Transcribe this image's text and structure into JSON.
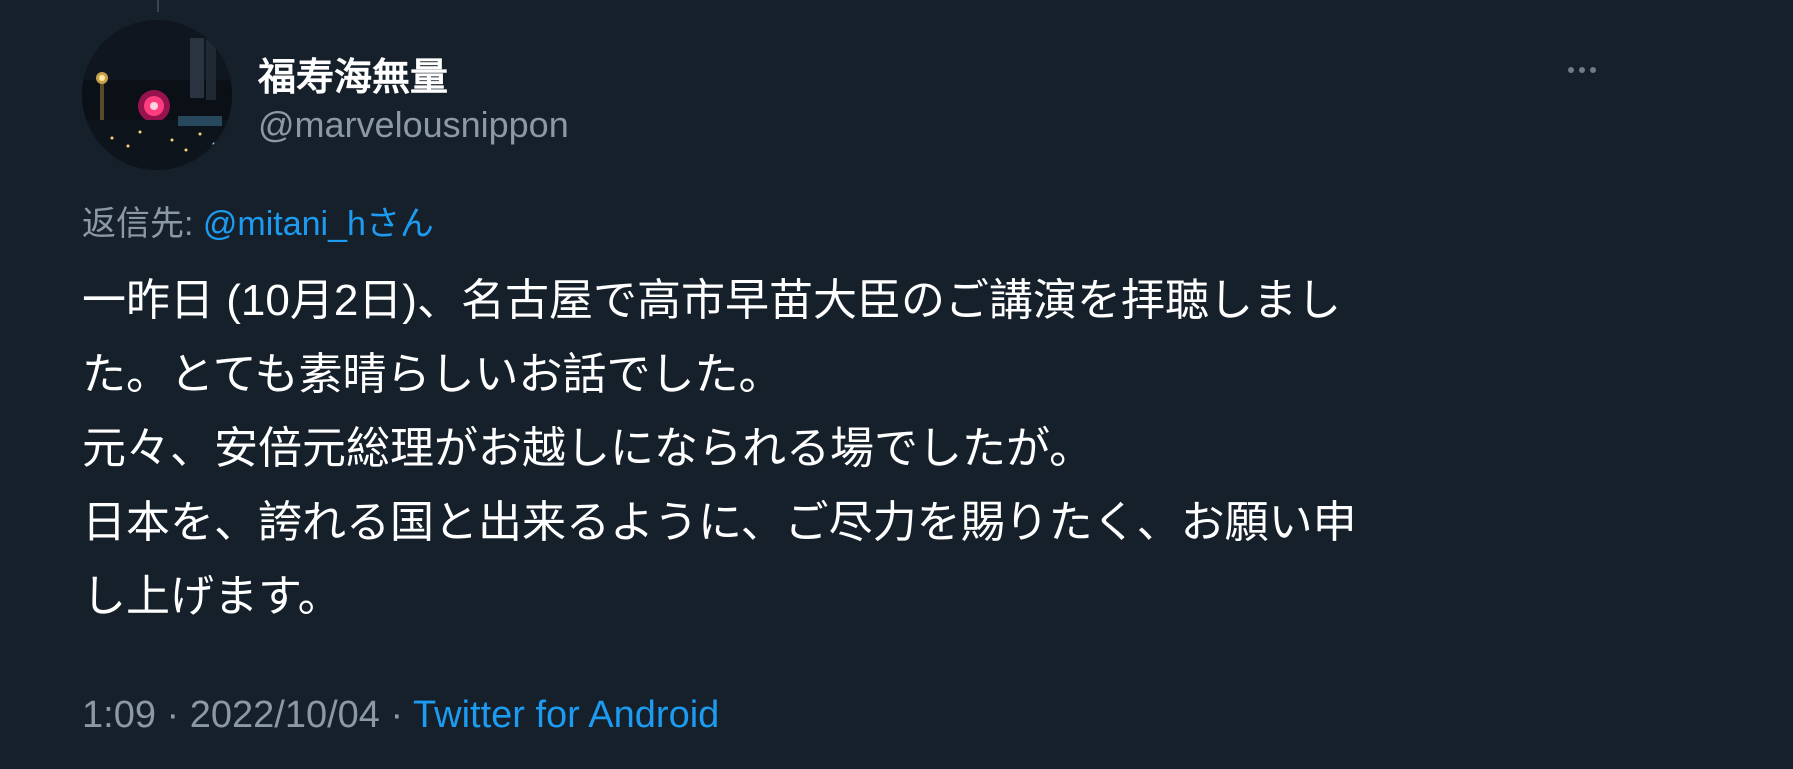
{
  "tweet": {
    "author": {
      "display_name": "福寿海無量",
      "handle": "@marvelousnippon",
      "avatar_icon": "avatar-night-cityscape"
    },
    "more_icon": "more-dots-icon",
    "reply_to": {
      "prefix": "返信先: ",
      "mention": "@mitani_h",
      "suffix": "さん"
    },
    "text_lines": [
      "一昨日 (10月2日)、名古屋で高市早苗大臣のご講演を拝聴しまし",
      "た。とても素晴らしいお話でした。",
      "元々、安倍元総理がお越しになられる場でしたが。",
      "日本を、誇れる国と出来るように、ご尽力を賜りたく、お願い申",
      "し上げます。"
    ],
    "meta": {
      "time": "1:09",
      "separator": " · ",
      "date": "2022/10/04",
      "source": "Twitter for Android"
    }
  },
  "colors": {
    "background": "#15202b",
    "text_primary": "#ffffff",
    "text_secondary": "#8b98a5",
    "accent": "#1d9bf0"
  }
}
